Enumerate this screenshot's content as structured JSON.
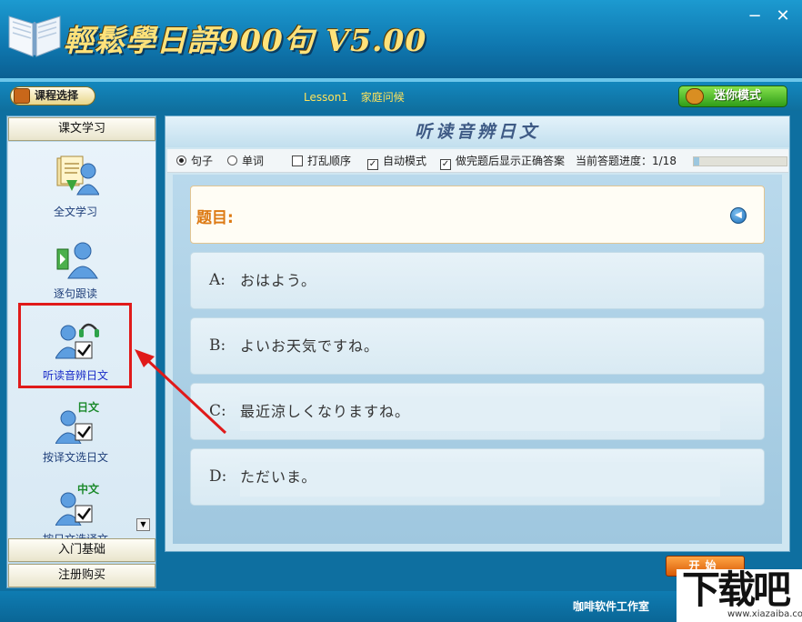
{
  "app": {
    "title": "輕鬆學日語900句 V5.00",
    "minimize": "−",
    "close": "✕"
  },
  "toolbar": {
    "course_select": "课程选择",
    "lesson": "Lesson1",
    "lesson_title": "家庭问候",
    "mini_mode": "迷你模式"
  },
  "sidebar": {
    "top_category": "课文学习",
    "items": [
      {
        "label": "全文学习",
        "icon": "document-person-icon"
      },
      {
        "label": "逐句跟读",
        "icon": "play-person-icon"
      },
      {
        "label": "听读音辨日文",
        "icon": "headphone-person-icon"
      },
      {
        "label": "按译文选日文",
        "icon": "japanese-person-icon",
        "badge": "日文"
      },
      {
        "label": "按日文选译文",
        "icon": "chinese-person-icon",
        "badge": "中文"
      }
    ],
    "bottom_categories": [
      "入门基础",
      "注册购买"
    ]
  },
  "main": {
    "section_title": "听读音辨日文",
    "options": {
      "sentence": "句子",
      "word": "单词",
      "shuffle": "打乱顺序",
      "auto_mode": "自动模式",
      "show_answer": "做完题后显示正确答案",
      "progress_label": "当前答题进度：1/18"
    },
    "state": {
      "sentence_selected": true,
      "word_selected": false,
      "shuffle_checked": false,
      "auto_checked": true,
      "show_answer_checked": true,
      "progress": 0.0556
    },
    "question_label": "题目:",
    "answers": [
      {
        "letter": "A:",
        "text": "おはよう。"
      },
      {
        "letter": "B:",
        "text": "よいお天気ですね。"
      },
      {
        "letter": "C:",
        "text": "最近涼しくなりますね。"
      },
      {
        "letter": "D:",
        "text": "ただいま。"
      }
    ],
    "start": "开始"
  },
  "footer": {
    "studio": "咖啡软件工作室",
    "watermark": "下载吧",
    "watermark_url": "www.xiazaiba.com"
  },
  "colors": {
    "highlight": "#e01a1a",
    "accent": "#dd7a14",
    "title": "#ffe27a"
  }
}
